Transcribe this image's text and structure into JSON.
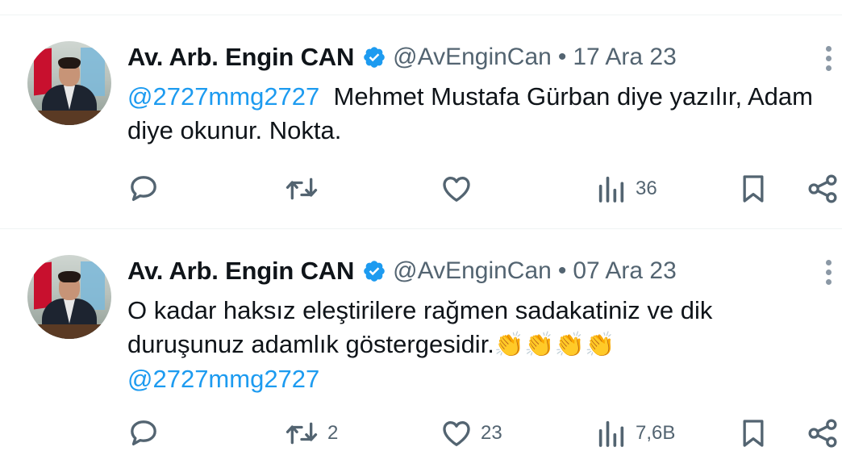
{
  "tweets": [
    {
      "author_name": "Av. Arb. Engin CAN",
      "handle": "@AvEnginCan",
      "separator": "•",
      "date": "17 Ara 23",
      "reply_mention": "@2727mmg2727",
      "text": "Mehmet Mustafa Gürban diye yazılır, Adam diye okunur. Nokta.",
      "views": "36",
      "replies": "",
      "retweets": "",
      "likes": ""
    },
    {
      "author_name": "Av. Arb. Engin CAN",
      "handle": "@AvEnginCan",
      "separator": "•",
      "date": "07 Ara 23",
      "text": "O kadar haksız eleştirilere rağmen sadakatiniz ve dik duruşunuz adamlık göstergesidir.",
      "emoji": "👏👏👏👏",
      "trailing_mention": "@2727mmg2727",
      "replies": "",
      "retweets": "2",
      "likes": "23",
      "views": "7,6B"
    }
  ],
  "colors": {
    "accent": "#1d9bf0",
    "text": "#0f1419",
    "secondary": "#536471",
    "divider": "#eff3f4"
  },
  "icons": [
    "verified-badge-icon",
    "more-icon",
    "reply-icon",
    "retweet-icon",
    "like-icon",
    "views-icon",
    "bookmark-icon",
    "share-icon"
  ]
}
